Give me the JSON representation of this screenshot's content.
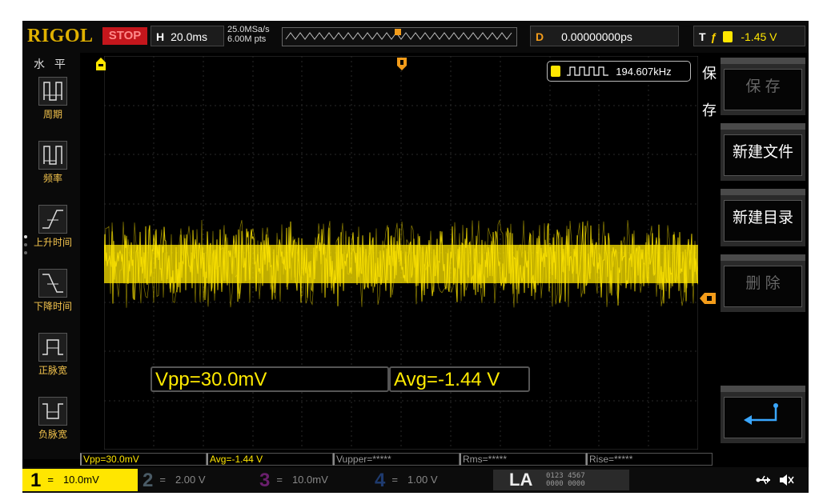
{
  "header": {
    "brand": "RIGOL",
    "run_state": "STOP",
    "horizontal_key": "H",
    "timebase": "20.0ms",
    "sample_rate": "25.0MSa/s",
    "memory_depth": "6.00M pts",
    "delay_key": "D",
    "delay_value": "0.00000000ps",
    "trigger_key": "T",
    "trigger_channel": "1",
    "trigger_level": "-1.45 V"
  },
  "left_panel": {
    "title": "水 平",
    "items": [
      {
        "label": "周期",
        "icon": "period-icon"
      },
      {
        "label": "频率",
        "icon": "frequency-icon"
      },
      {
        "label": "上升时间",
        "icon": "rise-time-icon"
      },
      {
        "label": "下降时间",
        "icon": "fall-time-icon"
      },
      {
        "label": "正脉宽",
        "icon": "positive-width-icon"
      },
      {
        "label": "负脉宽",
        "icon": "negative-width-icon"
      }
    ]
  },
  "frequency_counter": {
    "channel": "1",
    "value": "194.607kHz"
  },
  "measurements_big": {
    "vpp": "Vpp=30.0mV",
    "avg": "Avg=-1.44 V"
  },
  "measurements_row": [
    "Vpp=30.0mV",
    "Avg=-1.44 V",
    "Vupper=*****",
    "Rms=*****",
    "Rise=*****"
  ],
  "right_menu": {
    "title": "保存",
    "title_chars": [
      "保",
      "存"
    ],
    "buttons": [
      {
        "label": "保 存",
        "enabled": false
      },
      {
        "label": "新建文件",
        "enabled": true
      },
      {
        "label": "新建目录",
        "enabled": true
      },
      {
        "label": "删 除",
        "enabled": false
      },
      {
        "label": "",
        "icon": "return-icon",
        "enabled": true
      }
    ]
  },
  "channels": [
    {
      "num": "1",
      "coupling": "=",
      "scale": "10.0mV",
      "active": true,
      "color": "#ffe600"
    },
    {
      "num": "2",
      "coupling": "=",
      "scale": "2.00 V",
      "active": false,
      "color": "#4a5b66"
    },
    {
      "num": "3",
      "coupling": "=",
      "scale": "10.0mV",
      "active": false,
      "color": "#6a1f6d"
    },
    {
      "num": "4",
      "coupling": "=",
      "scale": "1.00 V",
      "active": false,
      "color": "#1e3a6e"
    }
  ],
  "la": {
    "label": "LA",
    "bits_top": "0123 4567",
    "bits_bottom": "0000 0000"
  },
  "colors": {
    "ch1": "#ffe600",
    "brand": "#e0b100",
    "stop": "#c4161c",
    "delay_key": "#f39c1a"
  },
  "icons": [
    "usb-icon",
    "speaker-mute-icon",
    "trigger-position-icon",
    "trigger-level-icon",
    "horizontal-marker-icon"
  ]
}
